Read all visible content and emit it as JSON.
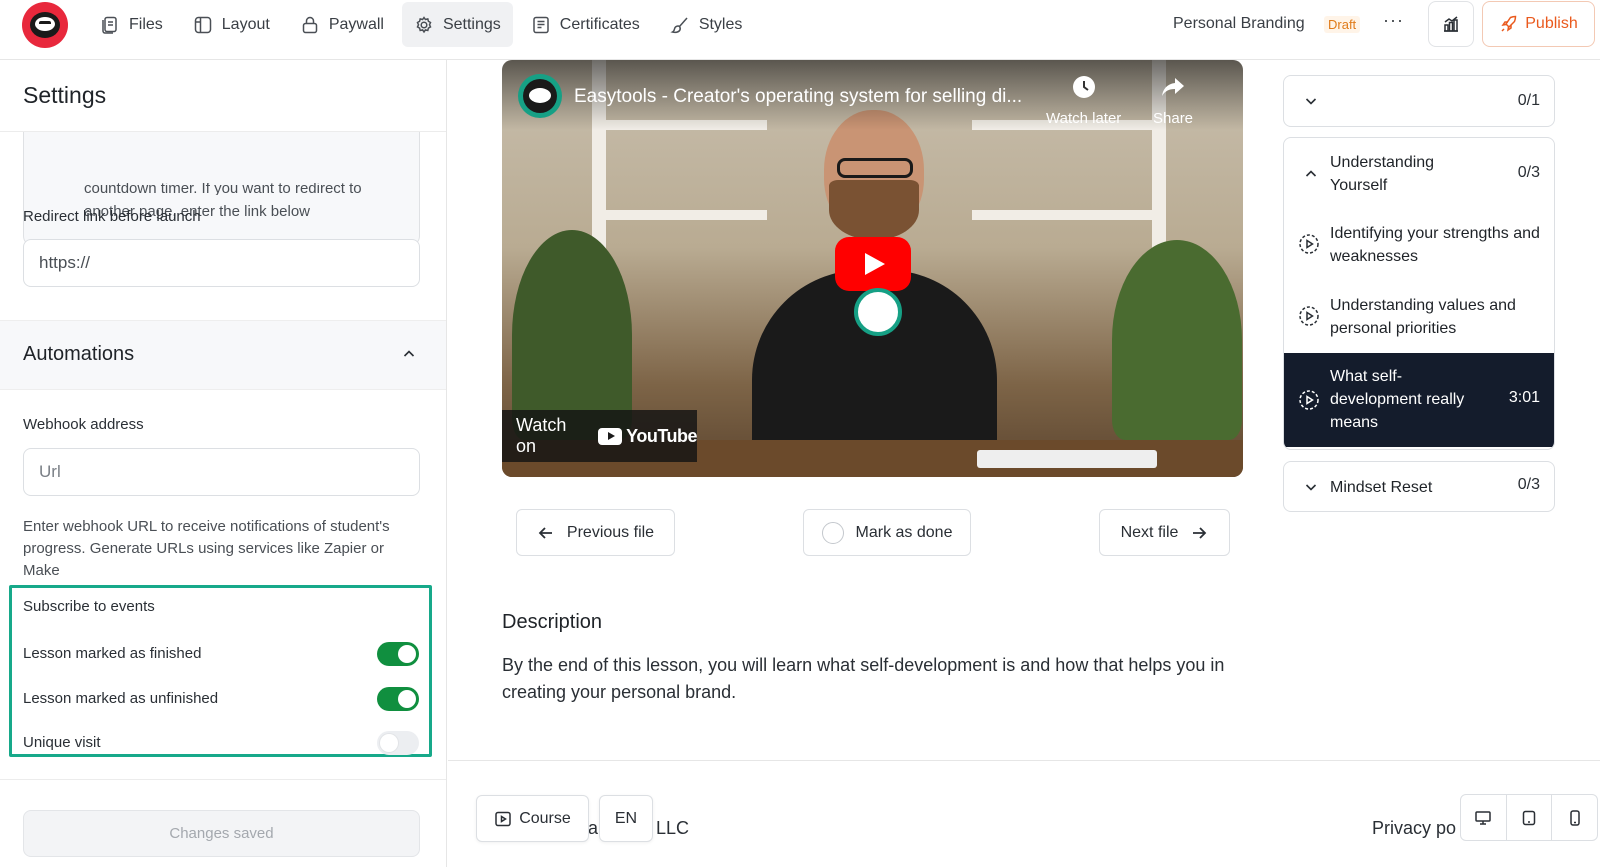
{
  "nav": {
    "items": [
      {
        "label": "Files",
        "icon": "files-icon",
        "active": false
      },
      {
        "label": "Layout",
        "icon": "layout-icon",
        "active": false
      },
      {
        "label": "Paywall",
        "icon": "lock-icon",
        "active": false
      },
      {
        "label": "Settings",
        "icon": "gear-icon",
        "active": true
      },
      {
        "label": "Certificates",
        "icon": "certificate-icon",
        "active": false
      },
      {
        "label": "Styles",
        "icon": "brush-icon",
        "active": false
      }
    ],
    "course_name": "Personal Branding",
    "status_badge": "Draft",
    "more_label": "···",
    "publish_label": "Publish"
  },
  "settings": {
    "title": "Settings",
    "note_line1": "countdown timer. If you want to redirect to",
    "note_line2": "another page, enter the link below",
    "redirect_label": "Redirect link before launch",
    "redirect_value": "https://",
    "automations_title": "Automations",
    "webhook_label": "Webhook address",
    "webhook_placeholder": "Url",
    "webhook_help": "Enter webhook URL to receive notifications of student's progress. Generate URLs using services like Zapier or Make",
    "events_label": "Subscribe to events",
    "events": [
      {
        "label": "Lesson marked as finished",
        "enabled": true
      },
      {
        "label": "Lesson marked as unfinished",
        "enabled": true
      },
      {
        "label": "Unique visit",
        "enabled": false
      }
    ],
    "save_label": "Changes saved"
  },
  "video": {
    "title": "Easytools - Creator's operating system for selling di...",
    "watch_later": "Watch later",
    "share": "Share",
    "watch_on": "Watch on",
    "youtube": "YouTube"
  },
  "lesson_nav": {
    "prev": "Previous file",
    "mark_done": "Mark as done",
    "next": "Next file"
  },
  "description": {
    "title": "Description",
    "text": "By the end of this lesson, you will learn what self-development is and how that helps you in creating your personal brand."
  },
  "footer": {
    "course_btn": "Course",
    "lang_btn": "EN",
    "partial_a": "a",
    "company": "LLC",
    "privacy": "Privacy po"
  },
  "curriculum": {
    "top_count": "0/1",
    "sections": [
      {
        "title": "Understanding Yourself",
        "count": "0/3",
        "lessons": [
          {
            "title": "Identifying your strengths and weaknesses"
          },
          {
            "title": "Understanding values and personal priorities"
          },
          {
            "title": "What self-development really means",
            "duration": "3:01",
            "active": true
          }
        ]
      },
      {
        "title": "Mindset Reset",
        "count": "0/3"
      }
    ]
  },
  "colors": {
    "accent_green": "#108f3f",
    "highlight": "#17a98a",
    "publish": "#ea5a1e",
    "active_lesson_bg": "#141c2c"
  }
}
